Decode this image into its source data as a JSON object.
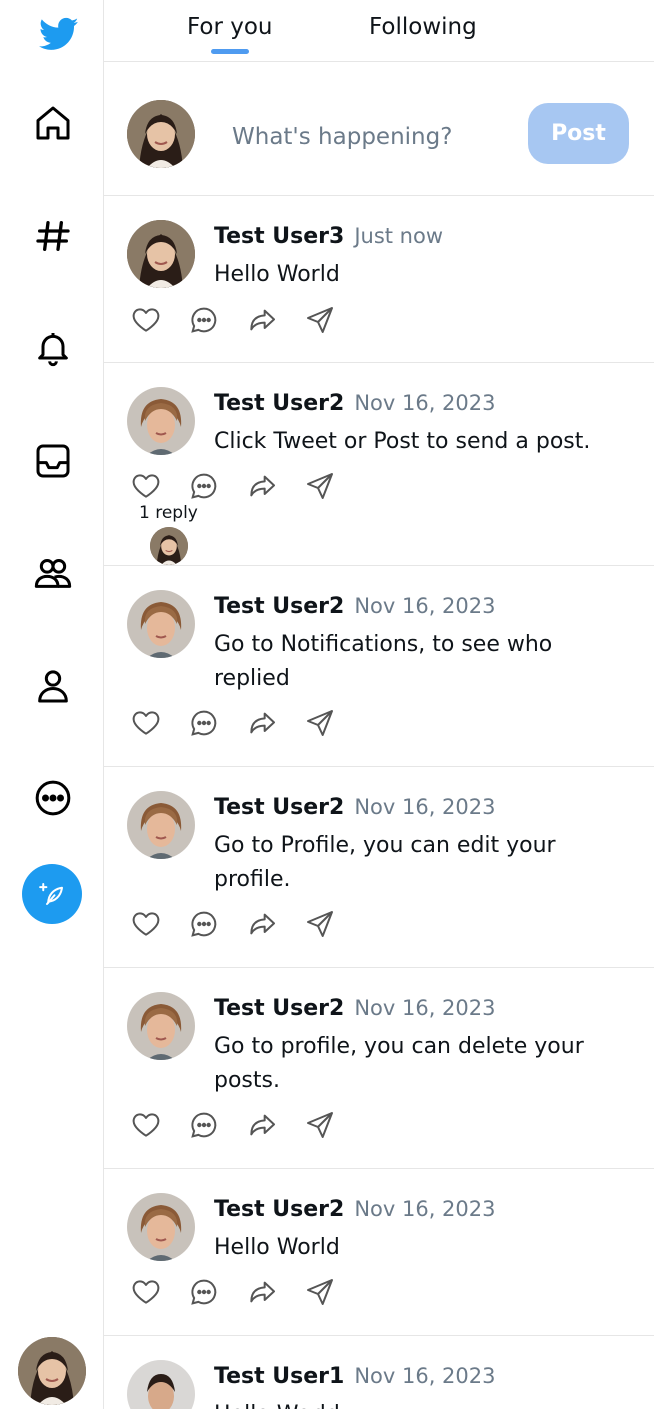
{
  "colors": {
    "accent": "#1d9bf0",
    "post_button_disabled": "#a7c7f2",
    "tab_indicator": "#4f9bf0",
    "muted_text": "#6b7a89"
  },
  "sidebar": {
    "items": [
      {
        "icon": "twitter-logo-icon"
      },
      {
        "icon": "home-icon"
      },
      {
        "icon": "hashtag-icon"
      },
      {
        "icon": "bell-icon"
      },
      {
        "icon": "inbox-icon"
      },
      {
        "icon": "people-icon"
      },
      {
        "icon": "profile-icon"
      },
      {
        "icon": "more-icon"
      }
    ],
    "compose_icon": "feather-icon"
  },
  "tabs": [
    {
      "label": "For you",
      "active": true
    },
    {
      "label": "Following",
      "active": false
    }
  ],
  "composer": {
    "placeholder": "What's happening?",
    "post_label": "Post"
  },
  "posts": [
    {
      "name": "Test User3",
      "time": "Just now",
      "text": "Hello World"
    },
    {
      "name": "Test User2",
      "time": "Nov 16, 2023",
      "text": "Click Tweet or Post to send a post.",
      "reply_label": "1 reply"
    },
    {
      "name": "Test User2",
      "time": "Nov 16, 2023",
      "text": "Go to Notifications, to see who replied"
    },
    {
      "name": "Test User2",
      "time": "Nov 16, 2023",
      "text": "Go to Profile, you can edit your profile."
    },
    {
      "name": "Test User2",
      "time": "Nov 16, 2023",
      "text": "Go to profile, you can delete your posts."
    },
    {
      "name": "Test User2",
      "time": "Nov 16, 2023",
      "text": "Hello World"
    },
    {
      "name": "Test User1",
      "time": "Nov 16, 2023",
      "text": "Hello World"
    }
  ]
}
